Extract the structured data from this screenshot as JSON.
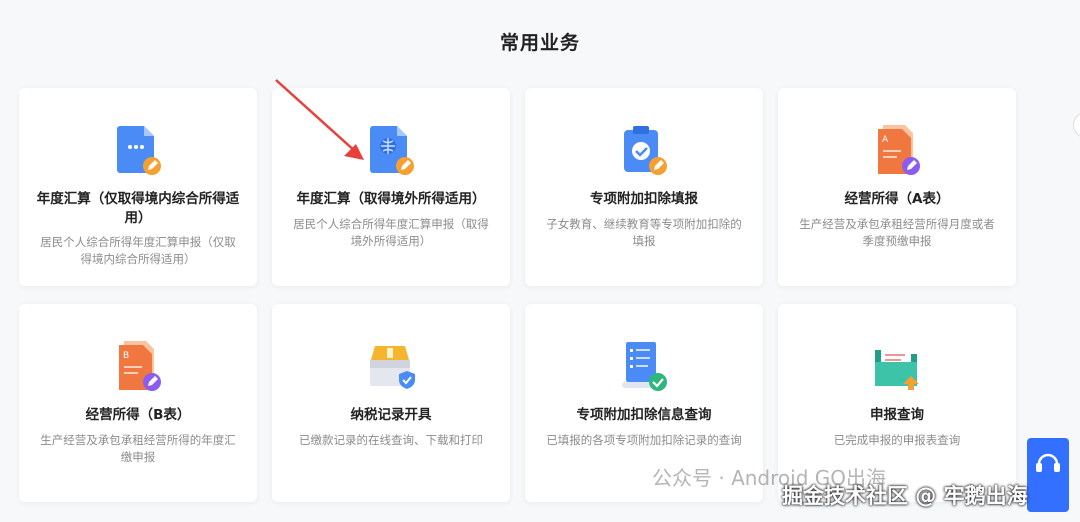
{
  "section_title": "常用业务",
  "cards": [
    {
      "title": "年度汇算（仅取得境内综合所得适用）",
      "desc": "居民个人综合所得年度汇算申报（仅取得境内综合所得适用）",
      "icon": "document-edit-icon"
    },
    {
      "title": "年度汇算（取得境外所得适用）",
      "desc": "居民个人综合所得年度汇算申报（取得境外所得适用）",
      "icon": "globe-document-icon"
    },
    {
      "title": "专项附加扣除填报",
      "desc": "子女教育、继续教育等专项附加扣除的填报",
      "icon": "clipboard-check-icon"
    },
    {
      "title": "经营所得（A表）",
      "desc": "生产经营及承包承租经营所得月度或者季度预缴申报",
      "icon": "form-a-icon"
    },
    {
      "title": "经营所得（B表）",
      "desc": "生产经营及承包承租经营所得的年度汇缴申报",
      "icon": "form-b-icon"
    },
    {
      "title": "纳税记录开具",
      "desc": "已缴款记录的在线查询、下载和打印",
      "icon": "tax-record-box-icon"
    },
    {
      "title": "专项附加扣除信息查询",
      "desc": "已填报的各项专项附加扣除记录的查询",
      "icon": "checklist-scroll-icon"
    },
    {
      "title": "申报查询",
      "desc": "已完成申报的申报表查询",
      "icon": "folder-upload-icon"
    }
  ],
  "watermark": {
    "line1": "公众号 · Android GO出海",
    "line2": "掘金技术社区 @ 牢鹅出海"
  },
  "colors": {
    "accent": "#3370ff",
    "orange": "#f5a030",
    "purple": "#8c5cf0"
  }
}
